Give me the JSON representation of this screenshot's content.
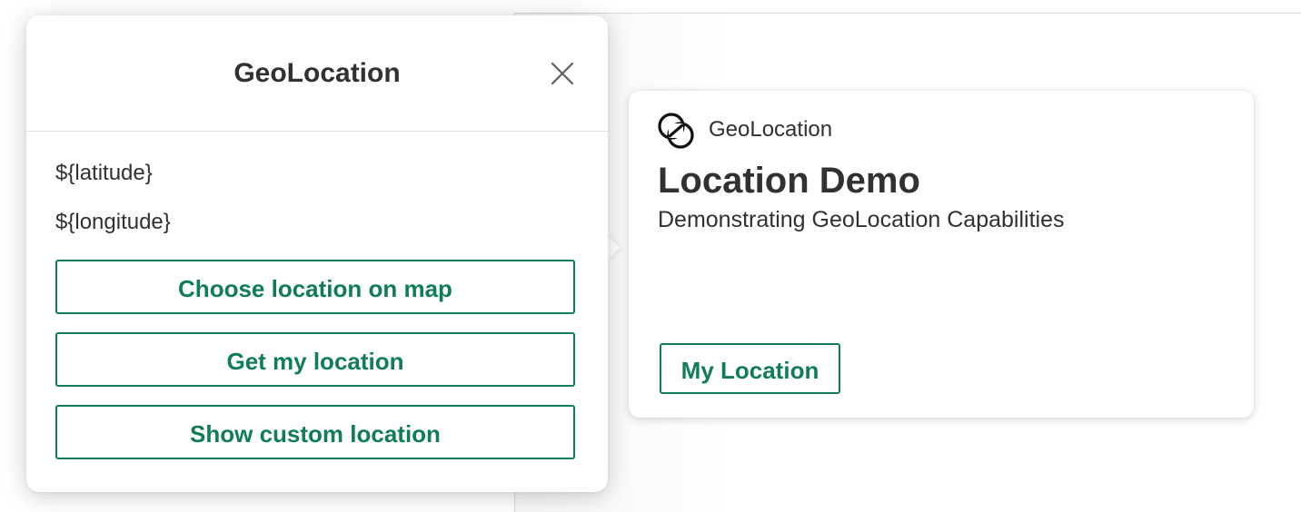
{
  "popup": {
    "title": "GeoLocation",
    "close_icon": "close-icon",
    "latitude": "${latitude}",
    "longitude": "${longitude}",
    "buttons": {
      "choose_on_map": "Choose location on map",
      "get_my_location": "Get my location",
      "show_custom": "Show custom location"
    }
  },
  "card": {
    "app_icon": "loop-logo-icon",
    "app_name": "GeoLocation",
    "title": "Location Demo",
    "subtitle": "Demonstrating GeoLocation Capabilities",
    "button_label": "My Location"
  },
  "colors": {
    "accent": "#107c5a",
    "text": "#323130",
    "divider": "#e1e1e1"
  }
}
